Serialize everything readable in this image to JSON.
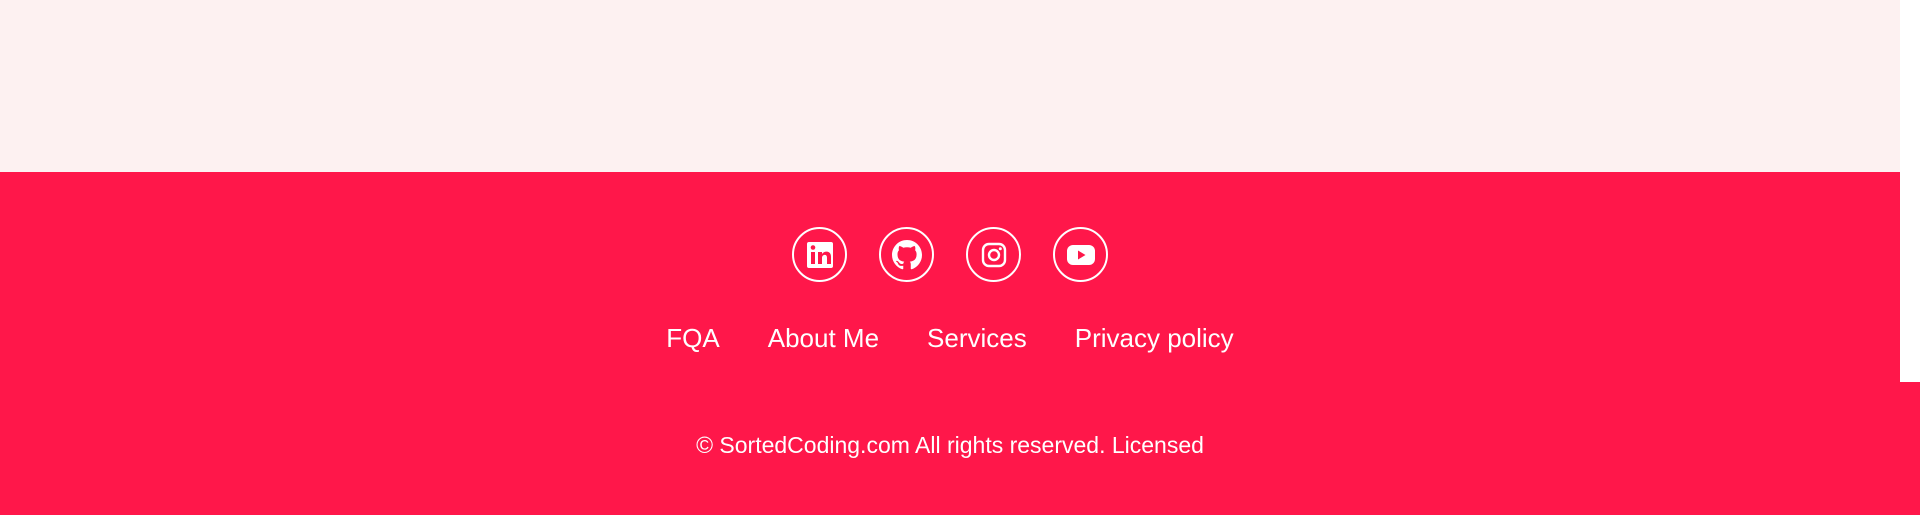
{
  "colors": {
    "top_band_bg": "#fdf1f1",
    "footer_bg": "#ff174a",
    "footer_text": "#ffffff"
  },
  "footer": {
    "social": [
      {
        "name": "linkedin",
        "icon": "linkedin-icon"
      },
      {
        "name": "github",
        "icon": "github-icon"
      },
      {
        "name": "instagram",
        "icon": "instagram-icon"
      },
      {
        "name": "youtube",
        "icon": "youtube-icon"
      }
    ],
    "nav": [
      {
        "label": "FQA"
      },
      {
        "label": "About Me"
      },
      {
        "label": "Services"
      },
      {
        "label": "Privacy policy"
      }
    ],
    "copyright": "© SortedCoding.com All rights reserved. Licensed"
  }
}
